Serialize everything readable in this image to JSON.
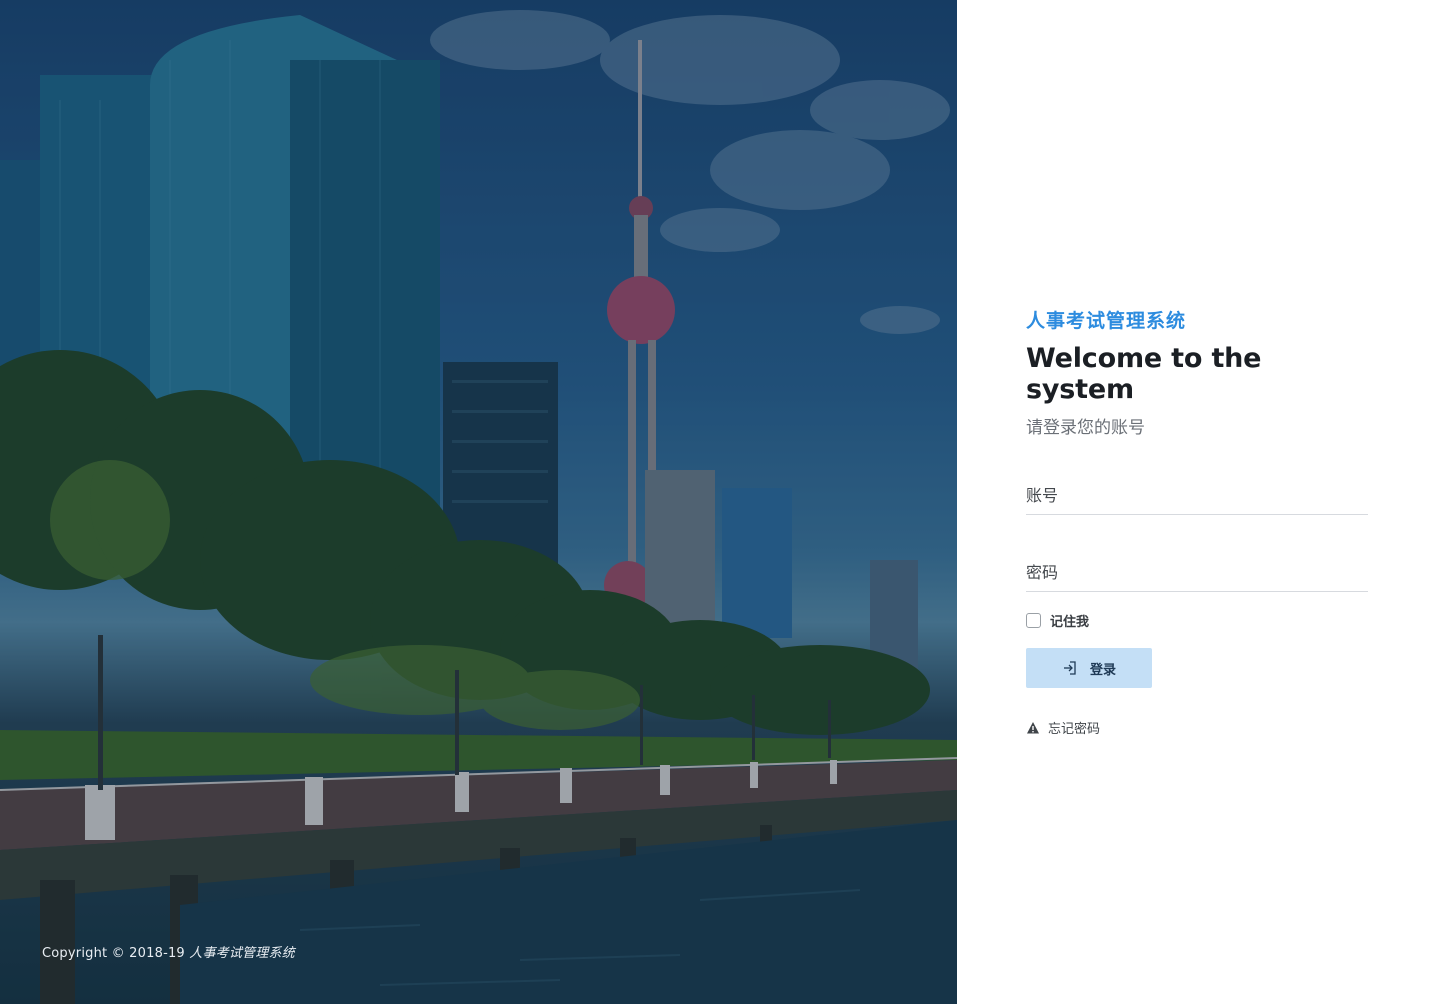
{
  "login": {
    "app_name": "人事考试管理系统",
    "welcome": "Welcome to the system",
    "subtitle": "请登录您的账号",
    "username_placeholder": "账号",
    "password_placeholder": "密码",
    "remember_label": "记住我",
    "login_label": "登录",
    "forgot_label": "忘记密码"
  },
  "footer": {
    "copyright_prefix": "Copyright © 2018-19",
    "copyright_brand": "人事考试管理系统"
  },
  "colors": {
    "accent": "#2d8cdf",
    "button_bg": "#c4dff6"
  },
  "icons": {
    "login": "sign-in-icon",
    "forgot": "warning-icon"
  }
}
